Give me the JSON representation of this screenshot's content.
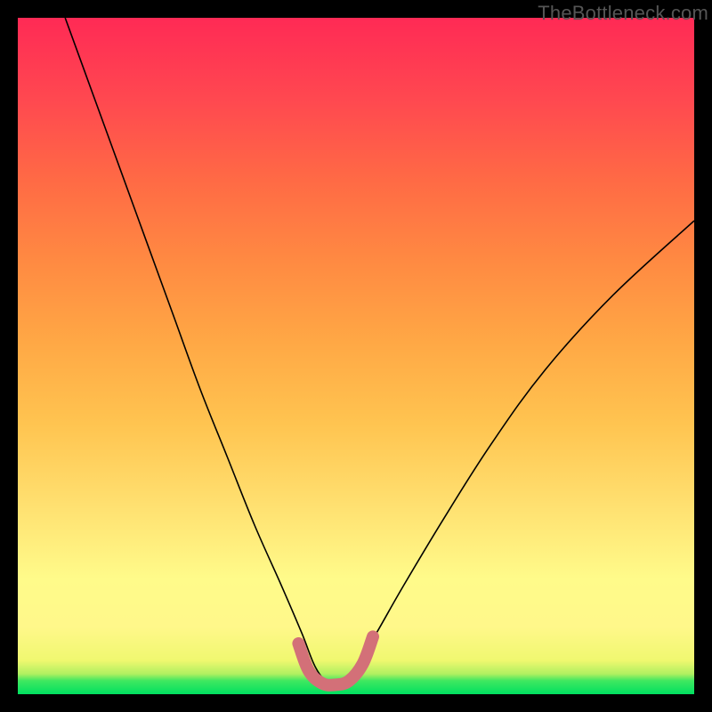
{
  "watermark": "TheBottleneck.com",
  "chart_data": {
    "type": "line",
    "title": "",
    "xlabel": "",
    "ylabel": "",
    "xlim": [
      0,
      100
    ],
    "ylim": [
      0,
      100
    ],
    "grid": false,
    "legend": false,
    "notes": "V-shaped bottleneck curve on vertical rainbow gradient (red top → green bottom). Minimum (optimal) region around x≈44–50 with thick pink highlight band at the bottom.",
    "series": [
      {
        "name": "bottleneck-curve",
        "color": "#000000",
        "x": [
          7,
          11,
          15,
          19,
          23,
          27,
          31,
          35,
          39,
          42,
          44,
          46,
          48,
          50,
          53,
          57,
          63,
          70,
          78,
          88,
          100
        ],
        "y": [
          100,
          89,
          78,
          67,
          56,
          45,
          35,
          25,
          16,
          9,
          4,
          1.5,
          1.4,
          4,
          9,
          16,
          26,
          37,
          48,
          59,
          70
        ]
      },
      {
        "name": "optimal-band",
        "color": "#d37078",
        "x": [
          41.5,
          43,
          45,
          47,
          49,
          51,
          52.5
        ],
        "y": [
          7.5,
          3.5,
          1.6,
          1.4,
          2.0,
          4.5,
          8.5
        ]
      }
    ]
  }
}
